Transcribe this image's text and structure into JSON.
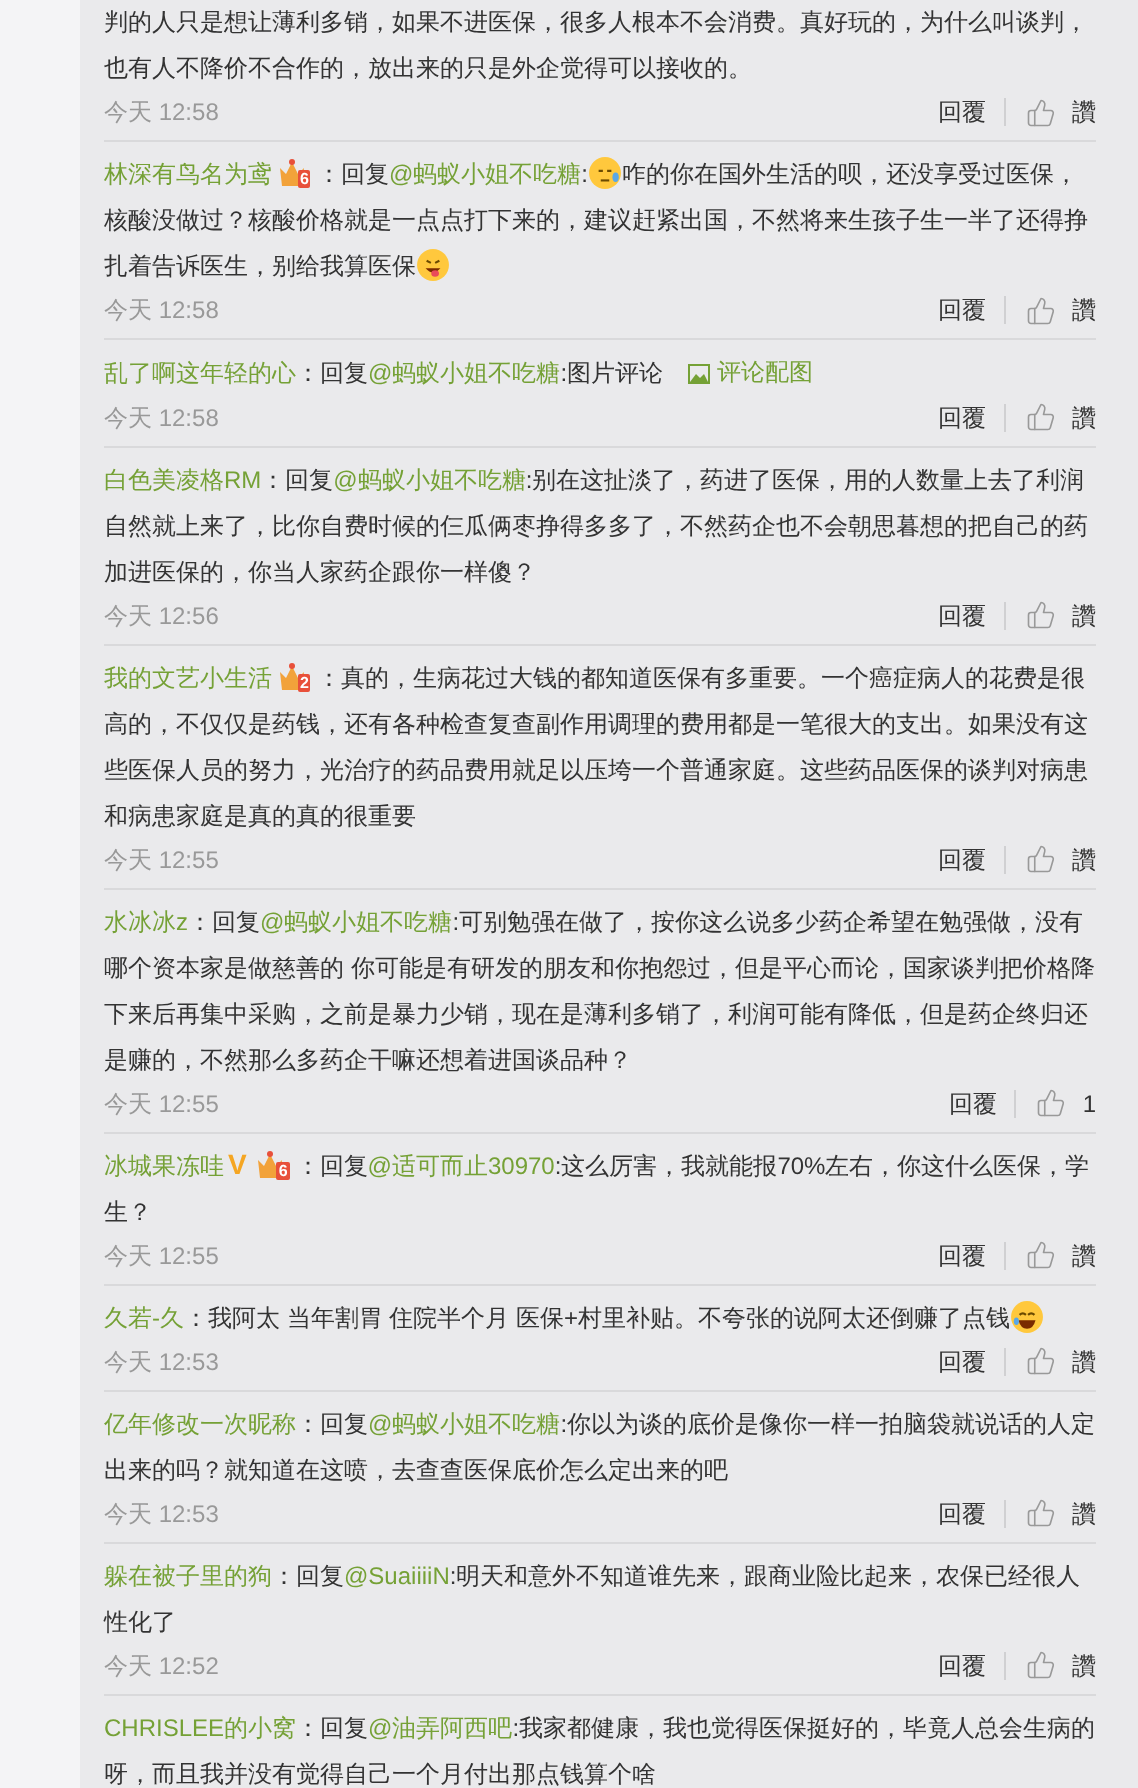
{
  "comments": [
    {
      "segments": [
        {
          "kind": "text",
          "text": "判的人只是想让薄利多销，如果不进医保，很多人根本不会消费。真好玩的，为什么叫谈判，也有人不降价不合作的，放出来的只是外企觉得可以接收的。"
        }
      ],
      "time": "今天 12:58",
      "reply": "回覆",
      "like": "讚"
    },
    {
      "user": "林深有鸟名为鸢",
      "badges": [
        {
          "kind": "member",
          "label": "6"
        }
      ],
      "segments": [
        {
          "kind": "text",
          "text": "：回复"
        },
        {
          "kind": "mention",
          "text": "@蚂蚁小姐不吃糖"
        },
        {
          "kind": "text",
          "text": ":"
        },
        {
          "kind": "emoji_sweat"
        },
        {
          "kind": "text",
          "text": "咋的你在国外生活的呗，还没享受过医保，核酸没做过？核酸价格就是一点点打下来的，建议赶紧出国，不然将来生孩子生一半了还得挣扎着告诉医生，别给我算医保"
        },
        {
          "kind": "emoji_tongue"
        }
      ],
      "time": "今天 12:58",
      "reply": "回覆",
      "like": "讚"
    },
    {
      "user": "乱了啊这年轻的心",
      "segments": [
        {
          "kind": "text",
          "text": "：回复"
        },
        {
          "kind": "mention",
          "text": "@蚂蚁小姐不吃糖"
        },
        {
          "kind": "text",
          "text": ":图片评论"
        },
        {
          "kind": "image_link",
          "text": "评论配图"
        }
      ],
      "time": "今天 12:58",
      "reply": "回覆",
      "like": "讚"
    },
    {
      "user": "白色美凌格RM",
      "segments": [
        {
          "kind": "text",
          "text": "：回复"
        },
        {
          "kind": "mention",
          "text": "@蚂蚁小姐不吃糖"
        },
        {
          "kind": "text",
          "text": ":别在这扯淡了，药进了医保，用的人数量上去了利润自然就上来了，比你自费时候的仨瓜俩枣挣得多多了，不然药企也不会朝思暮想的把自己的药加进医保的，你当人家药企跟你一样傻？"
        }
      ],
      "time": "今天 12:56",
      "reply": "回覆",
      "like": "讚"
    },
    {
      "user": "我的文艺小生活",
      "badges": [
        {
          "kind": "member",
          "label": "2"
        }
      ],
      "segments": [
        {
          "kind": "text",
          "text": "：真的，生病花过大钱的都知道医保有多重要。一个癌症病人的花费是很高的，不仅仅是药钱，还有各种检查复查副作用调理的费用都是一笔很大的支出。如果没有这些医保人员的努力，光治疗的药品费用就足以压垮一个普通家庭。这些药品医保的谈判对病患和病患家庭是真的真的很重要"
        }
      ],
      "time": "今天 12:55",
      "reply": "回覆",
      "like": "讚"
    },
    {
      "user": "水冰冰z",
      "segments": [
        {
          "kind": "text",
          "text": "：回复"
        },
        {
          "kind": "mention",
          "text": "@蚂蚁小姐不吃糖"
        },
        {
          "kind": "text",
          "text": ":可别勉强在做了，按你这么说多少药企希望在勉强做，没有哪个资本家是做慈善的 你可能是有研发的朋友和你抱怨过，但是平心而论，国家谈判把价格降下来后再集中采购，之前是暴力少销，现在是薄利多销了，利润可能有降低，但是药企终归还是赚的，不然那么多药企干嘛还想着进国谈品种？"
        }
      ],
      "time": "今天 12:55",
      "reply": "回覆",
      "like": "1"
    },
    {
      "user": "冰城果冻哇",
      "badges": [
        {
          "kind": "verified",
          "label": "V"
        },
        {
          "kind": "member",
          "label": "6"
        }
      ],
      "segments": [
        {
          "kind": "text",
          "text": "：回复"
        },
        {
          "kind": "mention",
          "text": "@适可而止30970"
        },
        {
          "kind": "text",
          "text": ":这么厉害，我就能报70%左右，你这什么医保，学生？"
        }
      ],
      "time": "今天 12:55",
      "reply": "回覆",
      "like": "讚"
    },
    {
      "user": "久若-久",
      "segments": [
        {
          "kind": "text",
          "text": "：我阿太 当年割胃 住院半个月 医保+村里补贴。不夸张的说阿太还倒赚了点钱"
        },
        {
          "kind": "emoji_laugh"
        }
      ],
      "time": "今天 12:53",
      "reply": "回覆",
      "like": "讚"
    },
    {
      "user": "亿年修改一次昵称",
      "segments": [
        {
          "kind": "text",
          "text": "：回复"
        },
        {
          "kind": "mention",
          "text": "@蚂蚁小姐不吃糖"
        },
        {
          "kind": "text",
          "text": ":你以为谈的底价是像你一样一拍脑袋就说话的人定出来的吗？就知道在这喷，去查查医保底价怎么定出来的吧"
        }
      ],
      "time": "今天 12:53",
      "reply": "回覆",
      "like": "讚"
    },
    {
      "user": "躲在被子里的狗",
      "segments": [
        {
          "kind": "text",
          "text": "：回复"
        },
        {
          "kind": "mention",
          "text": "@SuaiiiiN"
        },
        {
          "kind": "text",
          "text": ":明天和意外不知道谁先来，跟商业险比起来，农保已经很人性化了"
        }
      ],
      "time": "今天 12:52",
      "reply": "回覆",
      "like": "讚"
    },
    {
      "user": "CHRISLEE的小窝",
      "segments": [
        {
          "kind": "text",
          "text": "：回复"
        },
        {
          "kind": "mention",
          "text": "@油弄阿西吧"
        },
        {
          "kind": "text",
          "text": ":我家都健康，我也觉得医保挺好的，毕竟人总会生病的呀，而且我并没有觉得自己一个月付出那点钱算个啥"
        }
      ]
    }
  ]
}
